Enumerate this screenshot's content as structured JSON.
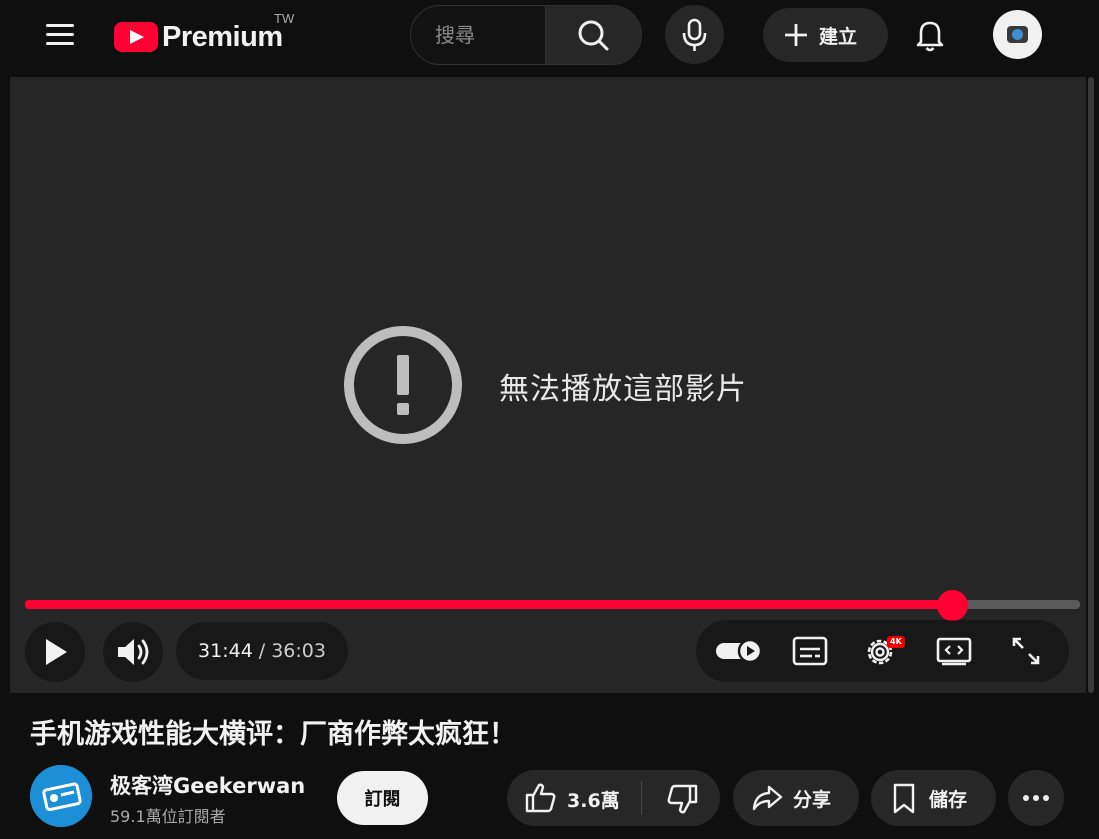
{
  "header": {
    "logo_text": "Premium",
    "region": "TW",
    "search_placeholder": "搜尋",
    "create_label": "建立"
  },
  "player": {
    "error_message": "無法播放這部影片",
    "progress_fraction": 0.88,
    "current_time": "31:44",
    "separator": "/",
    "duration": "36:03",
    "settings_badge": "4K",
    "accent_color": "#ff0033"
  },
  "video": {
    "title": "手机游戏性能大横评：厂商作弊太疯狂！",
    "channel_name": "极客湾Geekerwan",
    "subscribers": "59.1萬位訂閱者",
    "subscribe_label": "訂閱",
    "like_count": "3.6萬",
    "share_label": "分享",
    "save_label": "儲存"
  }
}
